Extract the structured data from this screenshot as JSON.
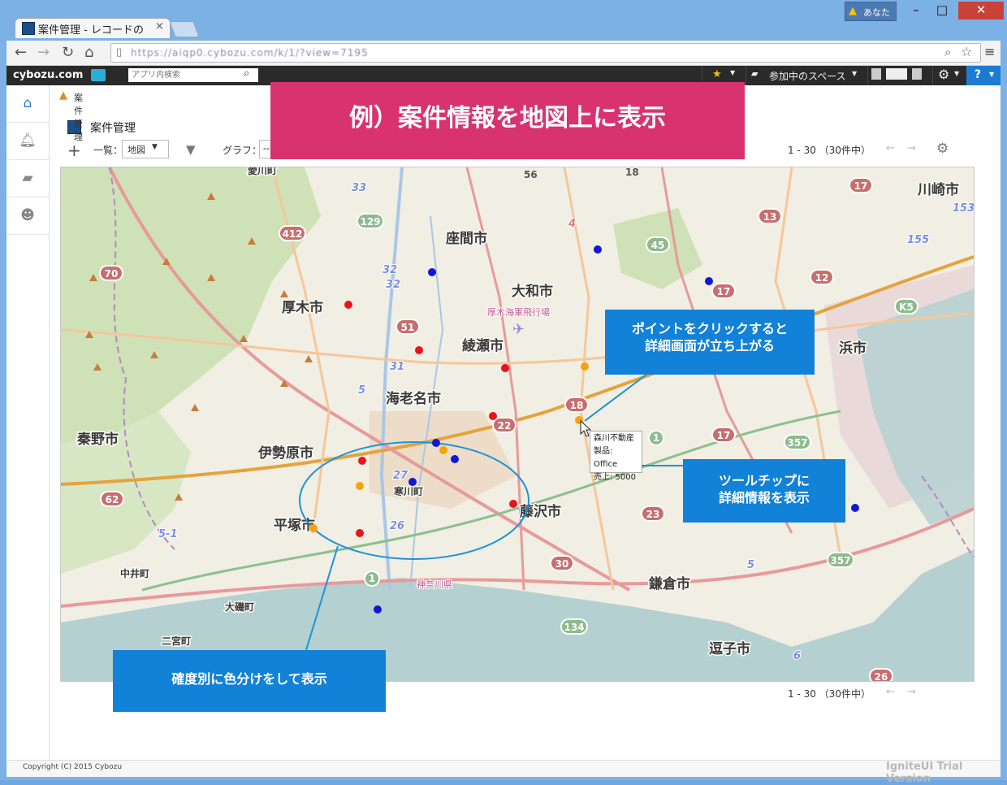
{
  "browser": {
    "tab_title": "案件管理 - レコードの",
    "tab_close": "×",
    "user_name": "あなた",
    "url": "https://aiqp0.cybozu.com/k/1/?view=7195"
  },
  "cybozu": {
    "logo": "cybozu.com",
    "search_placeholder": "アプリ内検索",
    "spaces_label": "参加中のスペース"
  },
  "breadcrumb": "案件管理",
  "app": {
    "title": "案件管理",
    "view_label": "一覧：",
    "view_value": "地図",
    "graph_label": "グラフ：",
    "graph_value": "--"
  },
  "paging": {
    "top": "1 - 30 （30件中）",
    "bottom": "1 - 30 （30件中）"
  },
  "banner": "例）案件情報を地図上に表示",
  "callouts": {
    "click": [
      "ポイントをクリックすると",
      "詳細画面が立ち上がる"
    ],
    "tooltip": [
      "ツールチップに",
      "詳細情報を表示"
    ],
    "color": "確度別に色分けをして表示"
  },
  "tooltip": {
    "company": "森川不動産",
    "product": "製品: Office",
    "sales": "売上: 5000"
  },
  "map": {
    "cities": [
      {
        "name": "座間市"
      },
      {
        "name": "大和市"
      },
      {
        "name": "厚木市"
      },
      {
        "name": "綾瀬市"
      },
      {
        "name": "海老名市"
      },
      {
        "name": "秦野市"
      },
      {
        "name": "伊勢原市"
      },
      {
        "name": "寒川町"
      },
      {
        "name": "平塚市"
      },
      {
        "name": "藤沢市"
      },
      {
        "name": "鎌倉市"
      },
      {
        "name": "逗子市"
      },
      {
        "name": "川崎市"
      },
      {
        "name": "浜市"
      },
      {
        "name": "中井町"
      },
      {
        "name": "大磯町"
      },
      {
        "name": "二宮町"
      },
      {
        "name": "愛川町"
      },
      {
        "name": "神奈川県"
      },
      {
        "name": "厚木海軍飛行場"
      }
    ],
    "colors": {
      "red": "#e8141c",
      "orange": "#f6a20c",
      "blue": "#1018d8"
    }
  },
  "footer": {
    "copyright": "Copyright (C) 2015 Cybozu",
    "trial": "IgniteUI Trial Version"
  }
}
